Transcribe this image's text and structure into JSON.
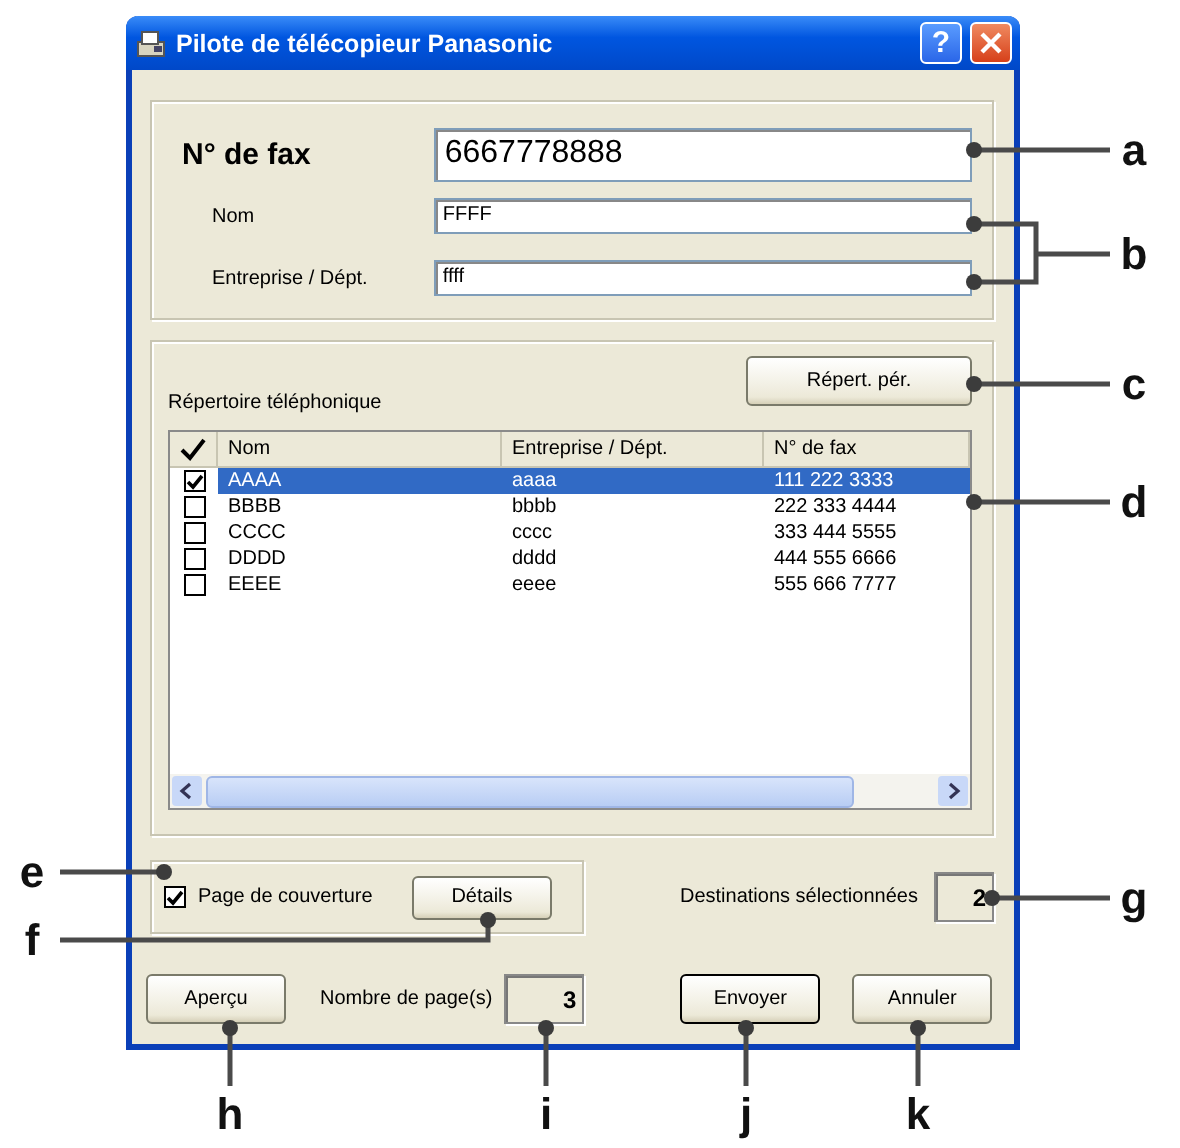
{
  "window": {
    "title": "Pilote de télécopieur Panasonic",
    "help": "?"
  },
  "recipient": {
    "fax_label": "N° de fax",
    "fax_value": "6667778888",
    "name_label": "Nom",
    "name_value": "FFFF",
    "company_label": "Entreprise / Dépt.",
    "company_value": "ffff"
  },
  "phonebook": {
    "label": "Répertoire téléphonique",
    "button": "Répert. pér.",
    "columns": [
      "Nom",
      "Entreprise / Dépt.",
      "N° de fax"
    ],
    "rows": [
      {
        "checked": true,
        "selected": true,
        "name": "AAAA",
        "company": "aaaa",
        "fax": "111 222 3333"
      },
      {
        "checked": false,
        "selected": false,
        "name": "BBBB",
        "company": "bbbb",
        "fax": "222 333 4444"
      },
      {
        "checked": false,
        "selected": false,
        "name": "CCCC",
        "company": "cccc",
        "fax": "333 444 5555"
      },
      {
        "checked": false,
        "selected": false,
        "name": "DDDD",
        "company": "dddd",
        "fax": "444 555 6666"
      },
      {
        "checked": false,
        "selected": false,
        "name": "EEEE",
        "company": "eeee",
        "fax": "555 666 7777"
      }
    ]
  },
  "cover_page": {
    "label": "Page de couverture",
    "checked": true,
    "button": "Détails"
  },
  "destinations": {
    "label": "Destinations sélectionnées",
    "value": "2"
  },
  "pages": {
    "label": "Nombre de page(s)",
    "value": "3"
  },
  "buttons": [
    {
      "kind": "preview",
      "label": "Aperçu"
    },
    {
      "kind": "send",
      "label": "Envoyer"
    },
    {
      "kind": "cancel",
      "label": "Annuler"
    }
  ],
  "callouts": [
    {
      "label": "a"
    },
    {
      "label": "b"
    },
    {
      "label": "c"
    },
    {
      "label": "d"
    },
    {
      "label": "e"
    },
    {
      "label": "f"
    },
    {
      "label": "g"
    },
    {
      "label": "h"
    },
    {
      "label": "i"
    },
    {
      "label": "j"
    },
    {
      "label": "k"
    }
  ]
}
